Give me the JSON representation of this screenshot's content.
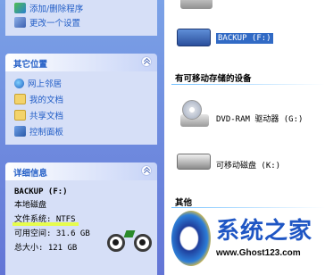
{
  "tasks": {
    "items": [
      {
        "label": "添加/删除程序",
        "icon": "add-remove-programs-icon"
      },
      {
        "label": "更改一个设置",
        "icon": "change-setting-icon"
      }
    ]
  },
  "other_places": {
    "title": "其它位置",
    "items": [
      {
        "label": "网上邻居",
        "icon": "network-places-icon"
      },
      {
        "label": "我的文档",
        "icon": "my-documents-icon"
      },
      {
        "label": "共享文档",
        "icon": "shared-documents-icon"
      },
      {
        "label": "控制面板",
        "icon": "control-panel-icon"
      }
    ]
  },
  "details": {
    "title": "详细信息",
    "drive_name": "BACKUP  (F:)",
    "drive_type": "本地磁盘",
    "filesystem": "文件系统: NTFS",
    "free_space": "可用空间: 31.6 GB",
    "total_size": "总大小: 121 GB"
  },
  "main": {
    "selected_drive": {
      "label": "BACKUP  (F:)",
      "icon": "hard-drive-icon"
    },
    "removable_group_title": "有可移动存储的设备",
    "removable_items": [
      {
        "label": "DVD-RAM 驱动器 (G:)",
        "icon": "dvd-drive-icon"
      },
      {
        "label": "可移动磁盘  (K:)",
        "icon": "removable-disk-icon"
      }
    ],
    "other_group_title": "其他"
  },
  "watermark": {
    "brand": "系统之家",
    "url": "www.Ghost123.com"
  },
  "colors": {
    "task_blue": "#215dc6",
    "selection": "#316ac5",
    "pane_gradient_top": "#7ba2e7",
    "pane_gradient_bottom": "#6375d6"
  }
}
